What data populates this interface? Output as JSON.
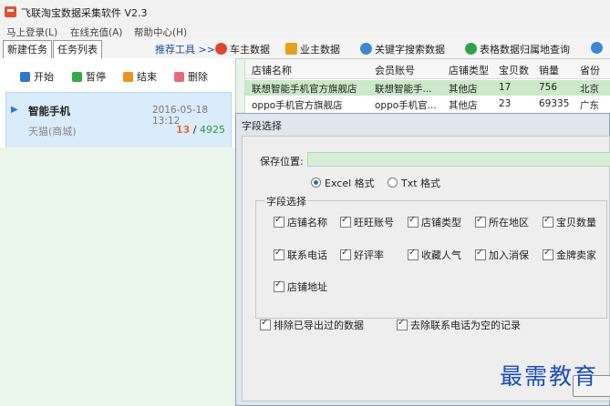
{
  "window": {
    "title": "飞联淘宝数据采集软件 V2.3"
  },
  "menu": {
    "items": [
      "马上登录(L)",
      "在线充值(A)",
      "帮助中心(H)"
    ]
  },
  "toolbar": {
    "tabs": [
      "新建任务",
      "任务列表"
    ],
    "recommend_label": "推荐工具 >>",
    "tools": [
      "车主数据",
      "业主数据",
      "关键字搜索数据",
      "表格数据归属地查询"
    ]
  },
  "actions": {
    "start": "开始",
    "pause": "暂停",
    "stop": "结束",
    "delete": "删除"
  },
  "task": {
    "name": "智能手机",
    "datetime": "2016-05-18 13:12",
    "source": "天猫(商城)",
    "progress_done": "13",
    "progress_sep": " / ",
    "progress_total": "4925"
  },
  "grid": {
    "headers": [
      "店铺名称",
      "会员账号",
      "店铺类型",
      "宝贝数",
      "销量",
      "省份"
    ],
    "rows": [
      [
        "联想智能手机官方旗舰店",
        "联想智能手...",
        "其他店",
        "17",
        "756",
        "北京"
      ],
      [
        "oppo手机官方旗舰店",
        "oppo手机官...",
        "其他店",
        "23",
        "69335",
        "广东"
      ]
    ]
  },
  "dialog": {
    "title": "字段选择",
    "save_location_label": "保存位置:",
    "save_location_value": "",
    "formats": [
      "Excel 格式",
      "Txt 格式"
    ],
    "field_group_label": "字段选择",
    "fields": [
      "店铺名称",
      "旺旺账号",
      "店铺类型",
      "所在地区",
      "宝贝数量",
      "联系电话",
      "好评率",
      "收藏人气",
      "加入消保",
      "金牌卖家",
      "店铺地址"
    ],
    "options": [
      "排除已导出过的数据",
      "去除联系电话为空的记录"
    ]
  },
  "watermark": "最需教育"
}
